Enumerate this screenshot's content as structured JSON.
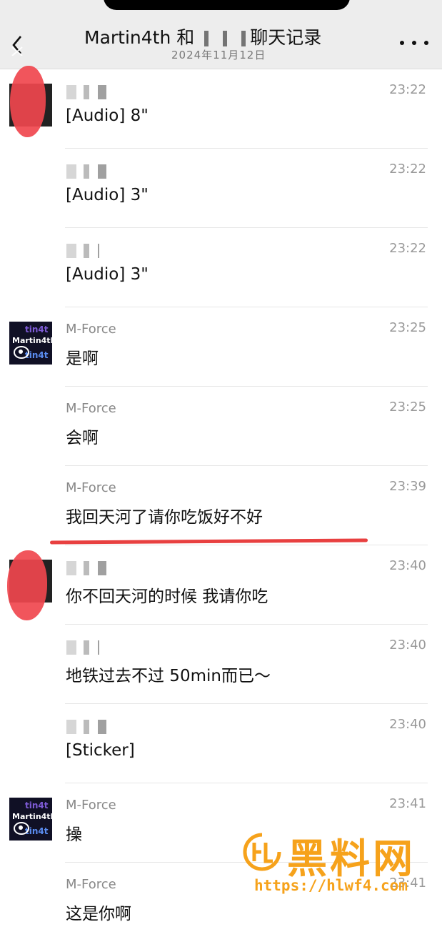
{
  "header": {
    "title_prefix": "Martin4th 和",
    "title_suffix": "聊天记录",
    "subtitle": "2024年11月12日"
  },
  "messages": [
    {
      "sender": "",
      "time": "23:22",
      "text": "[Audio]  8\"",
      "avatar": "redacted"
    },
    {
      "sender": "",
      "time": "23:22",
      "text": "[Audio]  3\"",
      "avatar": ""
    },
    {
      "sender": "",
      "time": "23:22",
      "text": "[Audio]  3\"",
      "avatar": ""
    },
    {
      "sender": "M-Force",
      "time": "23:25",
      "text": "是啊",
      "avatar": "martin4th"
    },
    {
      "sender": "M-Force",
      "time": "23:25",
      "text": "会啊",
      "avatar": ""
    },
    {
      "sender": "M-Force",
      "time": "23:39",
      "text": "我回天河了请你吃饭好不好",
      "avatar": ""
    },
    {
      "sender": "",
      "time": "23:40",
      "text": "你不回天河的时候 我请你吃",
      "avatar": "redacted"
    },
    {
      "sender": "",
      "time": "23:40",
      "text": "地铁过去不过 50min而已～",
      "avatar": ""
    },
    {
      "sender": "",
      "time": "23:40",
      "text": "[Sticker]",
      "avatar": ""
    },
    {
      "sender": "M-Force",
      "time": "23:41",
      "text": "操",
      "avatar": "martin4th"
    },
    {
      "sender": "M-Force",
      "time": "23:41",
      "text": "这是你啊",
      "avatar": ""
    }
  ],
  "avatar_label": "Martin4th",
  "watermark": {
    "text": "黑料网",
    "url": "https://hlwf4.com"
  },
  "colors": {
    "header_bg": "#ededed",
    "accent_red": "#e84040",
    "watermark": "#f6a21b"
  }
}
